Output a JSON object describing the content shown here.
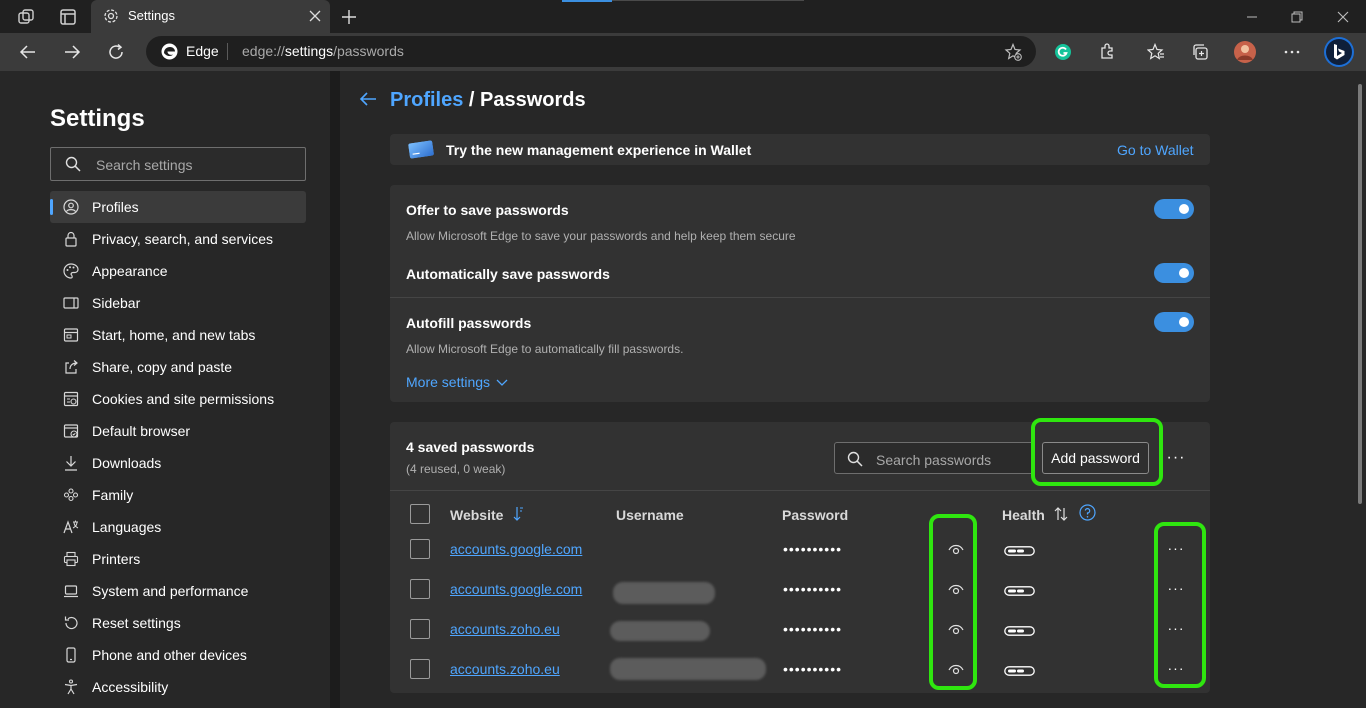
{
  "browser": {
    "tab_title": "Settings",
    "omnibox_label": "Edge",
    "url_scheme": "edge://",
    "url_host": "settings",
    "url_path": "/passwords"
  },
  "sidebar": {
    "title": "Settings",
    "search_placeholder": "Search settings",
    "items": [
      {
        "label": "Profiles",
        "icon": "profile-icon",
        "active": true
      },
      {
        "label": "Privacy, search, and services",
        "icon": "lock-icon"
      },
      {
        "label": "Appearance",
        "icon": "palette-icon"
      },
      {
        "label": "Sidebar",
        "icon": "sidebar-icon"
      },
      {
        "label": "Start, home, and new tabs",
        "icon": "home-tabs-icon"
      },
      {
        "label": "Share, copy and paste",
        "icon": "share-icon"
      },
      {
        "label": "Cookies and site permissions",
        "icon": "cookies-icon"
      },
      {
        "label": "Default browser",
        "icon": "default-browser-icon"
      },
      {
        "label": "Downloads",
        "icon": "download-icon"
      },
      {
        "label": "Family",
        "icon": "family-icon"
      },
      {
        "label": "Languages",
        "icon": "languages-icon"
      },
      {
        "label": "Printers",
        "icon": "printer-icon"
      },
      {
        "label": "System and performance",
        "icon": "laptop-icon"
      },
      {
        "label": "Reset settings",
        "icon": "reset-icon"
      },
      {
        "label": "Phone and other devices",
        "icon": "phone-icon"
      },
      {
        "label": "Accessibility",
        "icon": "accessibility-icon"
      }
    ]
  },
  "main": {
    "breadcrumb_parent": "Profiles",
    "breadcrumb_sep": " / ",
    "breadcrumb_current": "Passwords",
    "wallet_banner": {
      "text": "Try the new management experience in Wallet",
      "link": "Go to Wallet"
    },
    "settings": {
      "offer_title": "Offer to save passwords",
      "offer_desc": "Allow Microsoft Edge to save your passwords and help keep them secure",
      "autosave_title": "Automatically save passwords",
      "autofill_title": "Autofill passwords",
      "autofill_desc": "Allow Microsoft Edge to automatically fill passwords.",
      "more_settings": "More settings"
    },
    "passwords": {
      "count_title": "4 saved passwords",
      "count_sub": "(4 reused, 0 weak)",
      "search_placeholder": "Search passwords",
      "add_button": "Add password",
      "more": "···",
      "columns": {
        "website": "Website",
        "username": "Username",
        "password": "Password",
        "health": "Health"
      },
      "rows": [
        {
          "website": "accounts.google.com",
          "password": "••••••••••"
        },
        {
          "website": "accounts.google.com",
          "password": "••••••••••"
        },
        {
          "website": "accounts.zoho.eu",
          "password": "••••••••••"
        },
        {
          "website": "accounts.zoho.eu",
          "password": "••••••••••"
        }
      ],
      "row_more": "···"
    }
  },
  "colors": {
    "accent": "#4fa6ff",
    "toggle_on": "#3b8fe0",
    "annotation": "#2fe60f"
  }
}
